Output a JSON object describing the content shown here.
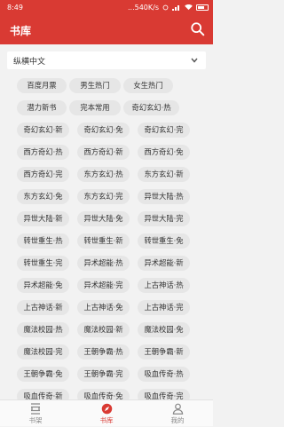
{
  "status": {
    "time": "8:49",
    "right_text": "...540K/s"
  },
  "header": {
    "title": "书库"
  },
  "filter": {
    "label": "纵横中文"
  },
  "chip_rows": [
    [
      "百度月票",
      "男生热门",
      "女生热门"
    ],
    [
      "潜力新书",
      "完本常用",
      "奇幻玄幻·热"
    ],
    [
      "奇幻玄幻·新",
      "奇幻玄幻·免",
      "奇幻玄幻·完"
    ],
    [
      "西方奇幻·热",
      "西方奇幻·新",
      "西方奇幻·免"
    ],
    [
      "西方奇幻·完",
      "东方玄幻·热",
      "东方玄幻·新"
    ],
    [
      "东方玄幻·免",
      "东方玄幻·完",
      "异世大陆·热"
    ],
    [
      "异世大陆·新",
      "异世大陆·免",
      "异世大陆·完"
    ],
    [
      "转世重生·热",
      "转世重生·新",
      "转世重生·免"
    ],
    [
      "转世重生·完",
      "异术超能·热",
      "异术超能·新"
    ],
    [
      "异术超能·免",
      "异术超能·完",
      "上古神话·热"
    ],
    [
      "上古神话·新",
      "上古神话·免",
      "上古神话·完"
    ],
    [
      "魔法校园·热",
      "魔法校园·新",
      "魔法校园·免"
    ],
    [
      "魔法校园·完",
      "王朝争霸·热",
      "王朝争霸·新"
    ],
    [
      "王朝争霸·免",
      "王朝争霸·完",
      "吸血传奇·热"
    ],
    [
      "吸血传奇·新",
      "吸血传奇·免",
      "吸血传奇·完"
    ]
  ],
  "bottom_nav": [
    {
      "label": "书架",
      "icon": "bookshelf-icon"
    },
    {
      "label": "书库",
      "icon": "compass-icon",
      "active": true
    },
    {
      "label": "我的",
      "icon": "person-icon"
    }
  ],
  "colors": {
    "accent": "#d93a33",
    "chip_bg": "#e6e6e6",
    "page_bg": "#f2f2f2"
  }
}
